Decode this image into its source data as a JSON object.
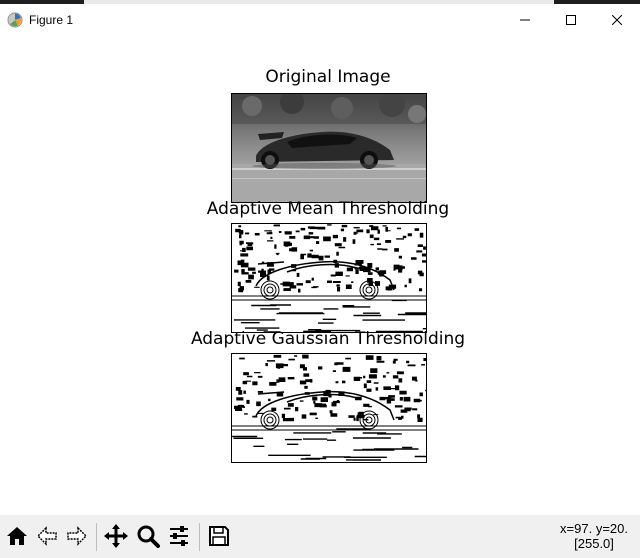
{
  "window": {
    "title": "Figure 1",
    "icon": "matplotlib-icon",
    "controls": [
      "minimize-icon",
      "maximize-icon",
      "close-icon"
    ]
  },
  "figure": {
    "axes": [
      {
        "title": "Original Image"
      },
      {
        "title": "Adaptive Mean Thresholding"
      },
      {
        "title": "Adaptive Gaussian Thresholding"
      }
    ]
  },
  "toolbar": {
    "buttons": [
      "home-icon",
      "back-icon",
      "forward-icon",
      "pan-icon",
      "zoom-icon",
      "configure-subplots-icon",
      "save-icon"
    ],
    "status_line1": "x=97. y=20.",
    "status_line2": "[255.0]"
  },
  "colors": {
    "window_bg": "#ffffff",
    "toolbar_bg": "#f0f0f0",
    "text": "#000000"
  }
}
